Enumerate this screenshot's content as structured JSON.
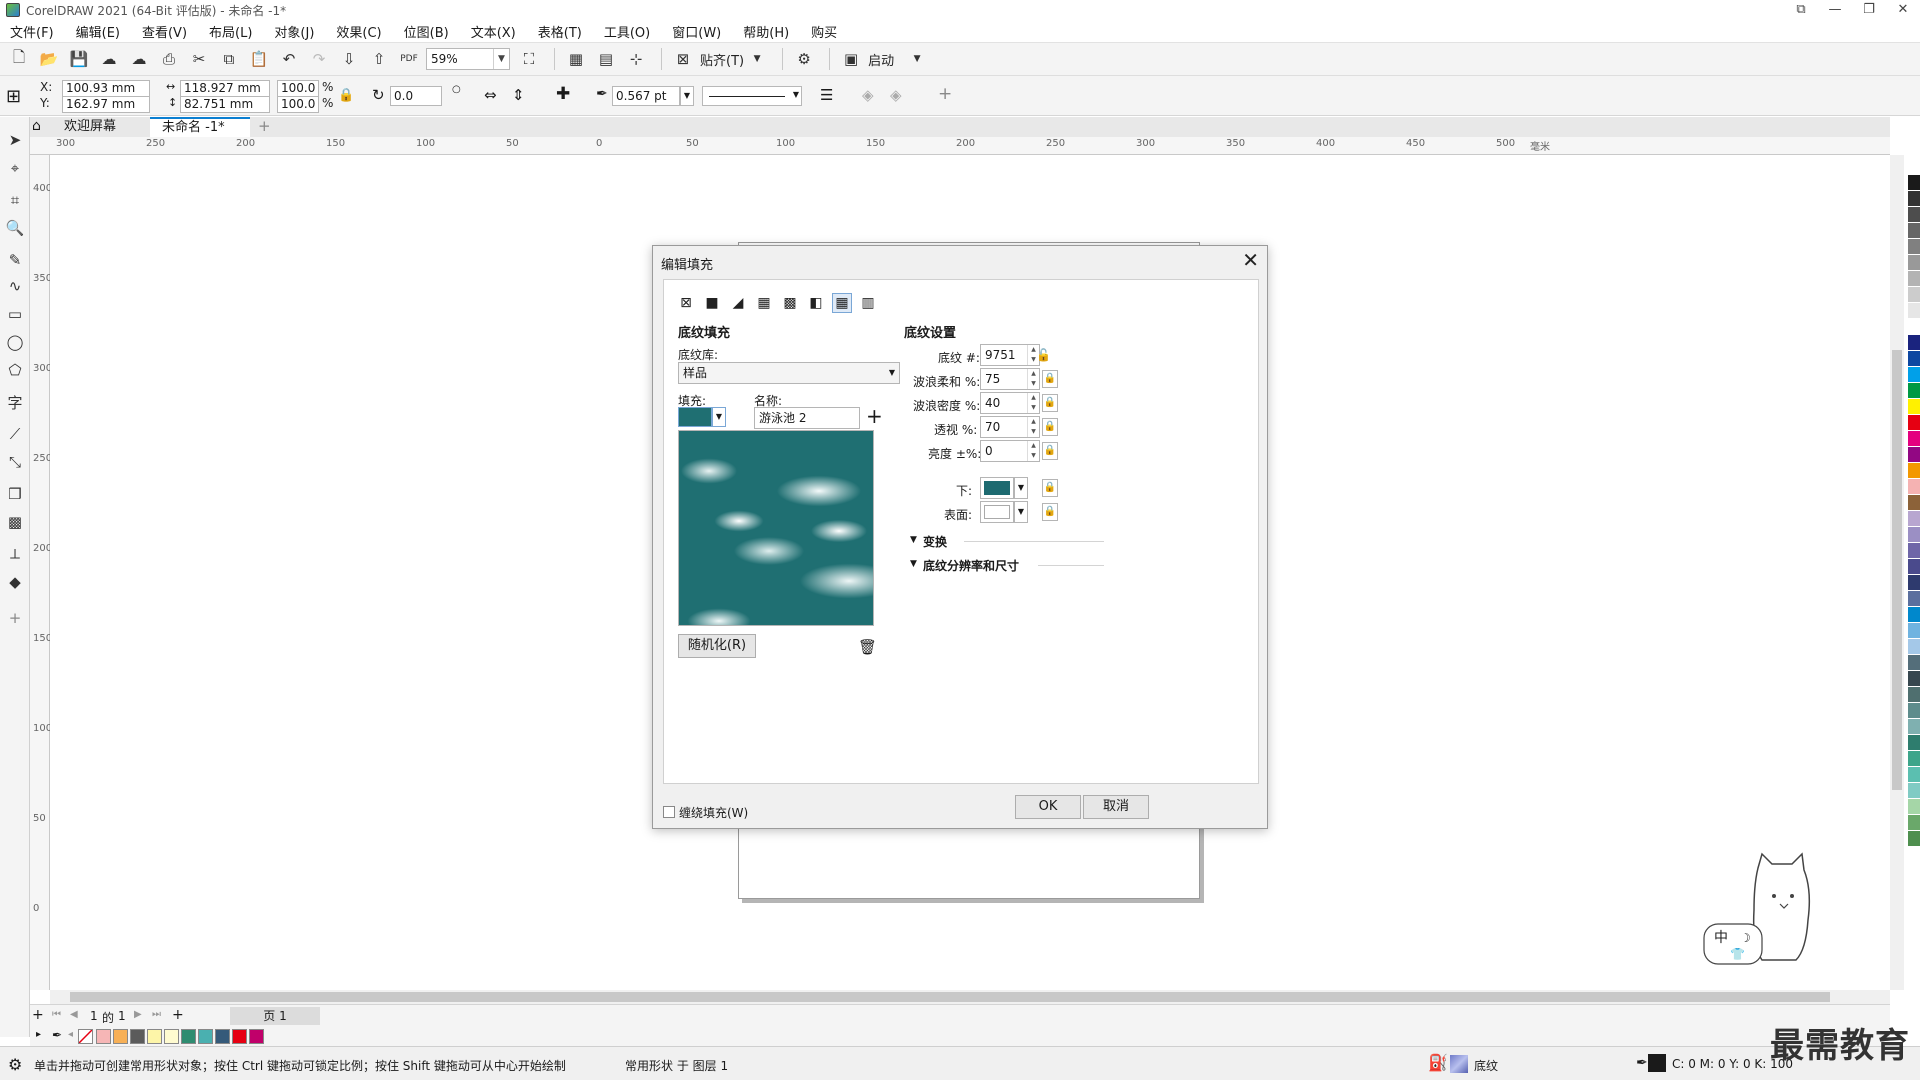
{
  "window": {
    "title": "CorelDRAW 2021 (64-Bit 评估版) - 未命名 -1*"
  },
  "menu": [
    "文件(F)",
    "编辑(E)",
    "查看(V)",
    "布局(L)",
    "对象(J)",
    "效果(C)",
    "位图(B)",
    "文本(X)",
    "表格(T)",
    "工具(O)",
    "窗口(W)",
    "帮助(H)",
    "购买"
  ],
  "standard_toolbar": {
    "zoom": "59%",
    "snap_label": "贴齐(T)",
    "launch_label": "启动"
  },
  "property_bar": {
    "x_label": "X:",
    "x": "100.93 mm",
    "y_label": "Y:",
    "y": "162.97 mm",
    "width": "118.927 mm",
    "height": "82.751 mm",
    "scale_w": "100.0",
    "scale_h": "100.0",
    "percent": "%",
    "rotation": "0.0",
    "outline": "0.567 pt"
  },
  "tabs": {
    "welcome": "欢迎屏幕",
    "document": "未命名 -1*"
  },
  "rulers": {
    "h": [
      "300",
      "250",
      "200",
      "150",
      "100",
      "50",
      "0",
      "50",
      "100",
      "150",
      "200",
      "250",
      "300",
      "350",
      "400",
      "450",
      "500"
    ],
    "v": [
      "400",
      "350",
      "300",
      "250",
      "200",
      "150",
      "100",
      "50",
      "0"
    ],
    "unit": "毫米"
  },
  "dialog": {
    "title": "编辑填充",
    "left_heading": "底纹填充",
    "library_label": "底纹库:",
    "library_value": "样品",
    "fill_label": "填充:",
    "name_label": "名称:",
    "name_value": "游泳池 2",
    "randomize": "随机化(R)",
    "right_heading": "底纹设置",
    "params": [
      {
        "label": "底纹 #:",
        "value": "9751"
      },
      {
        "label": "波浪柔和 %:",
        "value": "75"
      },
      {
        "label": "波浪密度 %:",
        "value": "40"
      },
      {
        "label": "透视 %:",
        "value": "70"
      },
      {
        "label": "亮度 ±%:",
        "value": "0"
      }
    ],
    "bottom_label": "下:",
    "surface_label": "表面:",
    "bottom_color": "#1d6a70",
    "surface_color": "#ffffff",
    "transform": "变换",
    "resolution": "底纹分辨率和尺寸",
    "wrap_fill": "缠绕填充(W)",
    "ok": "OK",
    "cancel": "取消"
  },
  "page_nav": {
    "current": "1",
    "of": "的",
    "total": "1",
    "page_tab": "页 1"
  },
  "status": {
    "hint": "单击并拖动可创建常用形状对象；按住 Ctrl 键拖动可锁定比例；按住 Shift 键拖动可从中心开始绘制",
    "object": "常用形状 于 图层 1",
    "fill_type": "底纹",
    "cmyk": "C: 0 M: 0 Y: 0 K: 100"
  },
  "mascot_text": "中",
  "watermark": "最需教育",
  "palette_colors": [
    "#1a1a1a",
    "#333333",
    "#4d4d4d",
    "#666666",
    "#808080",
    "#999999",
    "#b3b3b3",
    "#cccccc",
    "#e6e6e6",
    "#ffffff",
    "#1a237e",
    "#0d47a1",
    "#00a0e9",
    "#009944",
    "#fff100",
    "#e60012",
    "#e4007f",
    "#920783",
    "#f39800",
    "#f5b2b2",
    "#8c6239",
    "#b8a6d0",
    "#9b8fc4",
    "#6f66a8",
    "#4a4a8c",
    "#2e3a6e",
    "#5b6f9e",
    "#0088cc",
    "#6fb3e0",
    "#a4c8e8",
    "#546e7a",
    "#37474f",
    "#4f6f6f",
    "#5e8c8c",
    "#7fb0b0",
    "#2e7d6e",
    "#3da58a",
    "#5bbfb0",
    "#80cbc4",
    "#a5d6a7",
    "#6aa86a",
    "#4e8f4e"
  ],
  "doc_palette": [
    "#f6b6b6",
    "#f7b056",
    "#5b5b5b",
    "#fdf5a8",
    "#fffbd0",
    "#2e8c70",
    "#4ab0b0",
    "#355a7a",
    "#e60012",
    "#c0006a"
  ]
}
